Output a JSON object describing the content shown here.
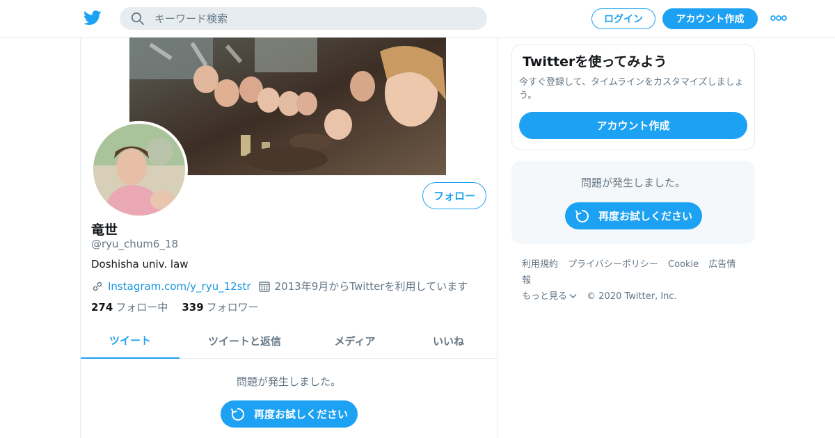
{
  "header": {
    "search_placeholder": "キーワード検索",
    "login_label": "ログイン",
    "signup_label": "アカウント作成",
    "brand_color": "#1da1f2"
  },
  "profile": {
    "display_name": "竜世",
    "handle": "@ryu_chum6_18",
    "bio": "Doshisha univ. law",
    "link": "Instagram.com/y_ryu_12str",
    "joined": "2013年9月からTwitterを利用しています",
    "following_count": "274",
    "following_label": "フォロー中",
    "followers_count": "339",
    "followers_label": "フォロワー",
    "follow_label": "フォロー"
  },
  "tabs": [
    {
      "label": "ツイート",
      "active": true
    },
    {
      "label": "ツイートと返信",
      "active": false
    },
    {
      "label": "メディア",
      "active": false
    },
    {
      "label": "いいね",
      "active": false
    }
  ],
  "timeline": {
    "error_text": "問題が発生しました。",
    "retry_label": "再度お試しください"
  },
  "sidebar": {
    "promo_title": "Twitterを使ってみよう",
    "promo_subtitle": "今すぐ登録して、タイムラインをカスタマイズしましょう。",
    "promo_button": "アカウント作成",
    "error_text": "問題が発生しました。",
    "retry_label": "再度お試しください"
  },
  "footer": {
    "links": [
      "利用規約",
      "プライバシーポリシー",
      "Cookie",
      "広告情報"
    ],
    "more_label": "もっと見る",
    "copyright": "© 2020 Twitter, Inc."
  }
}
